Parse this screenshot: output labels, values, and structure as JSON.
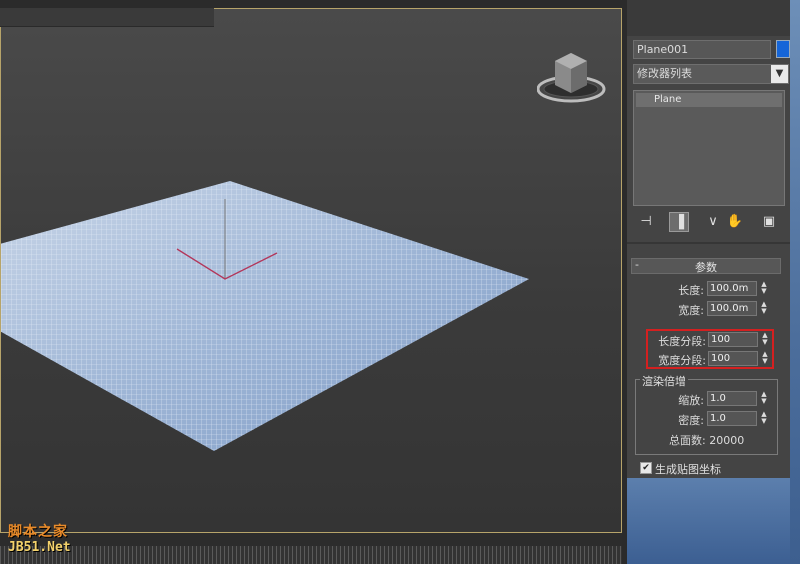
{
  "viewport": {
    "object_name": "Plane001"
  },
  "command_panel": {
    "name_value": "Plane001",
    "color_swatch": "#1565d8",
    "modifier_list_label": "修改器列表",
    "stack_items": [
      "Plane"
    ],
    "tools": [
      "pin-stack-icon",
      "show-end-result-icon",
      "make-unique-icon",
      "remove-modifier-icon",
      "configure-modifier-sets-icon"
    ]
  },
  "parameters": {
    "rollout_title": "参数",
    "rollout_collapse": "-",
    "length_label": "长度:",
    "length_value": "100.0m",
    "width_label": "宽度:",
    "width_value": "100.0m",
    "length_segs_label": "长度分段:",
    "length_segs_value": "100",
    "width_segs_label": "宽度分段:",
    "width_segs_value": "100",
    "render_group_label": "渲染倍增",
    "scale_label": "缩放:",
    "scale_value": "1.0",
    "density_label": "密度:",
    "density_value": "1.0",
    "total_faces": "总面数: 20000",
    "gen_uv_label": "生成贴图坐标",
    "gen_uv_checked": "✔"
  },
  "watermark": {
    "line1": "脚本之家",
    "line2": "JB51.Net"
  },
  "colors": {
    "highlight": "#d42020",
    "mesh": "#a9bfdc",
    "viewport_border": "#b7a46a"
  }
}
